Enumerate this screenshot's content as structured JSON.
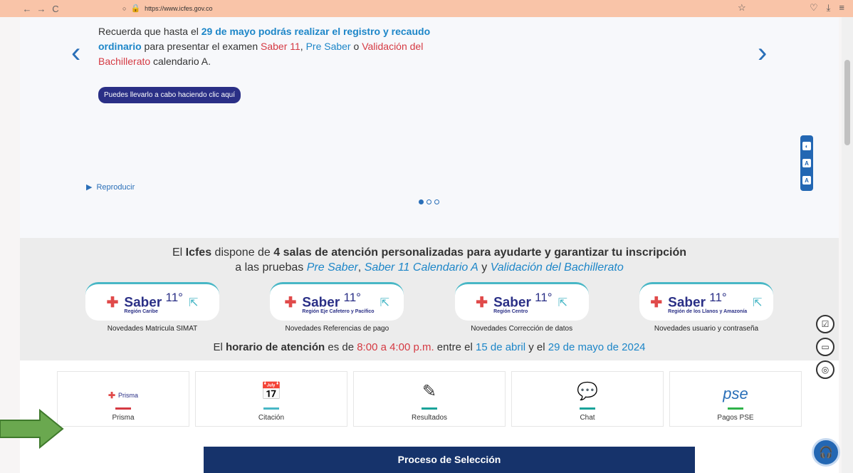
{
  "browser": {
    "url": "https://www.icfes.gov.co",
    "nav_back": "←",
    "nav_forward": "→",
    "nav_reload": "C"
  },
  "hero": {
    "text_1": "Recuerda que hasta el ",
    "date": "29 de mayo podrás realizar el registro y recaudo ordinario",
    "text_2": " para presentar el examen ",
    "exam_1": "Saber 11",
    "text_3": ", ",
    "exam_2": "Pre Saber",
    "text_4": " o ",
    "exam_3": "Validación del Bachillerato",
    "text_5": " calendario A.",
    "button": "Puedes llevarlo a cabo haciendo clic aquí",
    "play": "Reproducir"
  },
  "a11y": [
    "◐",
    "A",
    "A"
  ],
  "band": {
    "t1": "El ",
    "t2": "Icfes",
    "t3": " dispone de ",
    "t4": "4 salas de atención personalizadas para ayudarte y garantizar tu inscripción",
    "t5": "a las pruebas ",
    "t6": "Pre Saber",
    "t7": ", ",
    "t8": "Saber 11 Calendario A",
    "t9": " y ",
    "t10": "Validación del Bachillerato",
    "rooms": [
      {
        "brand": "Saber",
        "num": "11°",
        "region": "Región Caribe",
        "label": "Novedades Matricula SIMAT"
      },
      {
        "brand": "Saber",
        "num": "11°",
        "region": "Región Eje Cafetero y Pacífico",
        "label": "Novedades Referencias de pago"
      },
      {
        "brand": "Saber",
        "num": "11°",
        "region": "Región Centro",
        "label": "Novedades Corrección de datos"
      },
      {
        "brand": "Saber",
        "num": "11°",
        "region": "Región de los Llanos y Amazonía",
        "label": "Novedades usuario y contraseña"
      }
    ],
    "h1": "El ",
    "h2": "horario de atención",
    "h3": " es de ",
    "h4": "8:00 a 4:00 p.m.",
    "h5": " entre el ",
    "h6": "15 de abril",
    "h7": " y el ",
    "h8": "29 de mayo de 2024"
  },
  "services": [
    {
      "label": "Prisma",
      "logo": "Prisma",
      "line_color": "#d53a43"
    },
    {
      "label": "Citación",
      "line_color": "#48b7c6"
    },
    {
      "label": "Resultados",
      "line_color": "#1aa39a"
    },
    {
      "label": "Chat",
      "line_color": "#1aa39a"
    },
    {
      "label": "Pagos PSE",
      "logo": "pse",
      "line_color": "#2fb34a"
    }
  ],
  "promo": "Proceso de Selección"
}
